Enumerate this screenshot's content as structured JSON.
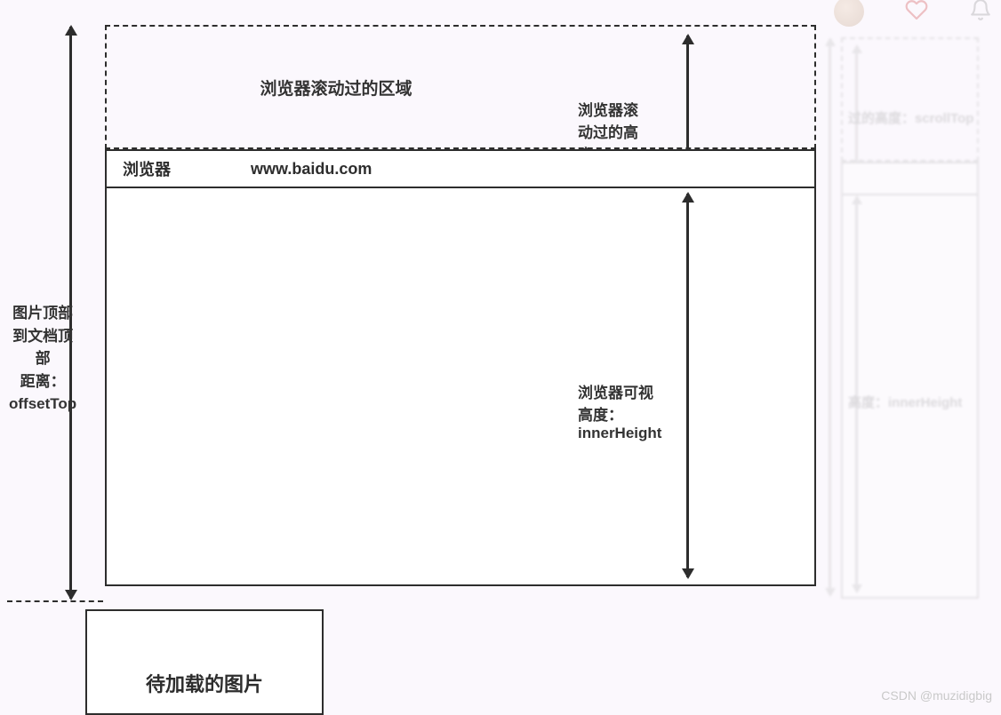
{
  "diagram": {
    "scrolled_area_label": "浏览器滚动过的区域",
    "browser_label": "浏览器",
    "browser_url": "www.baidu.com",
    "offsettop_label_line1": "图片顶部到文档顶部",
    "offsettop_label_line2": "距离：offsetTop",
    "scrolltop_label": "浏览器滚动过的高度：scrollTop",
    "innerheight_label": "浏览器可视高度：innerHeight",
    "pending_image_label": "待加载的图片"
  },
  "ghost": {
    "scrolltop_fragment": "过的高度：scrollTop",
    "innerheight_fragment": "高度：innerHeight"
  },
  "watermark": "CSDN @muzidigbig"
}
